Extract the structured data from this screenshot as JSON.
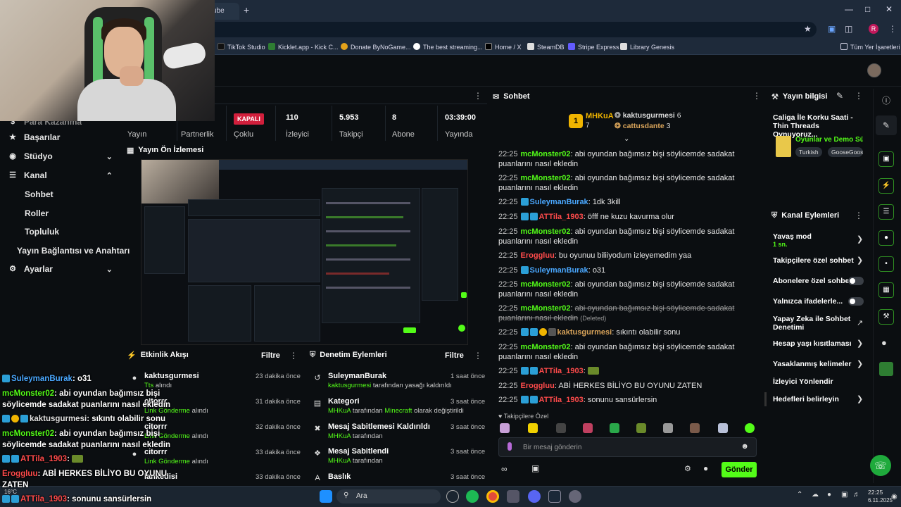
{
  "browser": {
    "tab_title": "ube",
    "new_tab": "+",
    "bookmarks": [
      "TikTok Studio",
      "Kicklet.app - Kick C...",
      "Donate ByNoGame...",
      "The best streaming...",
      "Home / X",
      "SteamDB",
      "Stripe Express",
      "Library Genesis"
    ],
    "all_bookmarks": "Tüm Yer İşaretleri",
    "profile_letter": "R"
  },
  "sidebar": {
    "cut_item": "Para Kazanma",
    "items": [
      {
        "label": "Başarılar",
        "icon": "trophy-icon"
      },
      {
        "label": "Stüdyo",
        "icon": "studio-icon"
      },
      {
        "label": "Kanal",
        "icon": "channel-icon"
      }
    ],
    "sub_items": [
      "Sohbet",
      "Roller",
      "Topluluk",
      "Yayın Bağlantısı ve Anahtarı"
    ],
    "settings": "Ayarlar"
  },
  "stats": {
    "cut_labels": [
      "Yayın",
      "Partnerlik"
    ],
    "multi_badge": "KAPALI",
    "multi_label": "Çoklu",
    "viewers": "110",
    "viewers_label": "İzleyici",
    "followers": "5.953",
    "followers_label": "Takipçi",
    "subs": "8",
    "subs_label": "Abone",
    "uptime": "03:39:00",
    "uptime_label": "Yayında"
  },
  "preview": {
    "title": "Yayın Ön İzlemesi"
  },
  "activity": {
    "title": "Etkinlik Akışı",
    "filter": "Filtre",
    "rows": [
      {
        "name": "kaktusgurmesi",
        "sub": "Tts",
        "sub2": "alındı",
        "time": "23 dakika önce"
      },
      {
        "name": "citorrr",
        "sub": "Link Gönderme",
        "sub2": "alındı",
        "time": "31 dakika önce"
      },
      {
        "name": "citorrr",
        "sub": "Link Gönderme",
        "sub2": "alındı",
        "time": "32 dakika önce"
      },
      {
        "name": "citorrr",
        "sub": "Link Gönderme",
        "sub2": "alındı",
        "time": "33 dakika önce"
      },
      {
        "name": "lankedisi",
        "sub": "",
        "sub2": "",
        "time": "33 dakika önce"
      }
    ]
  },
  "moderation": {
    "title": "Denetim Eylemleri",
    "filter": "Filtre",
    "rows": [
      {
        "name": "SuleymanBurak",
        "sub": "kaktusgurmesi",
        "sub2": "tarafından yasağı kaldırıldı",
        "time": "1 saat önce"
      },
      {
        "name": "Kategori",
        "sub": "MHKuA",
        "sub2": "tarafından",
        "sub3": "Minecraft",
        "sub4": "olarak değiştirildi",
        "time": "3 saat önce"
      },
      {
        "name": "Mesaj Sabitlemesi Kaldırıldı",
        "sub": "MHKuA",
        "sub2": "tarafından",
        "time": "3 saat önce"
      },
      {
        "name": "Mesaj Sabitlendi",
        "sub": "MHKuA",
        "sub2": "tarafından",
        "time": "3 saat önce"
      },
      {
        "name": "Baslık",
        "sub": "",
        "sub2": "",
        "time": "3 saat önce"
      }
    ]
  },
  "chat": {
    "title": "Sohbet",
    "leader_rank": "1",
    "leader_name": "MHKuA",
    "leader_count": "7",
    "top2_name": "kaktusgurmesi",
    "top2_count": "6",
    "top3_name": "cattusdante",
    "top3_count": "3",
    "messages": [
      {
        "time": "22:25",
        "user": "mcMonster02",
        "color": "#53fc18",
        "text": "abi oyundan bağımsız bişi söylicemde sadakat puanlarını nasıl ekledin"
      },
      {
        "time": "22:25",
        "user": "mcMonster02",
        "color": "#53fc18",
        "text": "abi oyundan bağımsız bişi söylicemde sadakat puanlarını nasıl ekledin"
      },
      {
        "time": "22:25",
        "user": "SuleymanBurak",
        "color": "#4aa8ff",
        "text": "1dk 3kill"
      },
      {
        "time": "22:25",
        "user": "ATTila_1903",
        "color": "#ff4b4b",
        "text": "öfff ne kuzu kavurma olur"
      },
      {
        "time": "22:25",
        "user": "mcMonster02",
        "color": "#53fc18",
        "text": "abi oyundan bağımsız bişi söylicemde sadakat puanlarını nasıl ekledin"
      },
      {
        "time": "22:25",
        "user": "Eroggluu",
        "color": "#ff4b4b",
        "text": "bu oyunuu biliiyodum izleyemedim yaa"
      },
      {
        "time": "22:25",
        "user": "SuleymanBurak",
        "color": "#4aa8ff",
        "text": "o31"
      },
      {
        "time": "22:25",
        "user": "mcMonster02",
        "color": "#53fc18",
        "text": "abi oyundan bağımsız bişi söylicemde sadakat puanlarını nasıl ekledin"
      },
      {
        "time": "22:25",
        "user": "mcMonster02",
        "color": "#53fc18",
        "text": "abi oyundan bağımsız bişi söylicemde sadakat puanlarını nasıl ekledin",
        "deleted": "(Deleted)"
      },
      {
        "time": "22:25",
        "user": "kaktusgurmesi",
        "color": "#d9a45a",
        "text": "sıkıntı olabilir sonu"
      },
      {
        "time": "22:25",
        "user": "mcMonster02",
        "color": "#53fc18",
        "text": "abi oyundan bağımsız bişi söylicemde sadakat puanlarını nasıl ekledin"
      },
      {
        "time": "22:25",
        "user": "ATTila_1903",
        "color": "#ff4b4b",
        "text": ""
      },
      {
        "time": "22:25",
        "user": "Eroggluu",
        "color": "#ff4b4b",
        "text": "ABİ HERKES BİLİYO BU OYUNU ZATEN"
      },
      {
        "time": "22:25",
        "user": "ATTila_1903",
        "color": "#ff4b4b",
        "text": "sonunu sansürlersin"
      }
    ],
    "followers_only": "Takipçilere Özel",
    "placeholder": "Bir mesaj gönderin",
    "send": "Gönder"
  },
  "stream_info": {
    "title": "Yayın bilgisi",
    "stream_title": "Caliga İle Korku Saati - Thin Threads Oynuyoruz...",
    "category": "Oyunlar ve Demo Sür",
    "tags": [
      "Turkish",
      "GooseGoos"
    ]
  },
  "channel_actions": {
    "title": "Kanal Eylemleri",
    "slow_mode": "Yavaş mod",
    "slow_value": "1 sn.",
    "items": [
      "Takipçilere özel sohbet",
      "Abonelere özel sohbet",
      "Yalnızca ifadelerle...",
      "Yapay Zeka ile Sohbet Denetimi",
      "Hesap yaşı kısıtlaması",
      "Yasaklanmış kelimeler",
      "İzleyici Yönlendir",
      "Hedefleri belirleyin"
    ]
  },
  "overlay_chat": [
    {
      "user": "SuleymanBurak",
      "text": ": o31"
    },
    {
      "user": "mcMonster02",
      "text": ": abi oyundan bağımsız bişi"
    },
    {
      "user": "",
      "text": "söylicemde sadakat puanlarını nasıl ekledin"
    },
    {
      "user": "kaktusgurmesi",
      "text": ": sıkıntı olabilir sonu"
    },
    {
      "user": "mcMonster02",
      "text": ": abi oyundan bağımsız bişi"
    },
    {
      "user": "",
      "text": "söylicemde sadakat puanlarını nasıl ekledin"
    },
    {
      "user": "ATTila_1903",
      "text": ":"
    },
    {
      "user": "Eroggluu",
      "text": ": ABİ HERKES BİLİYO BU OYUNU"
    },
    {
      "user": "",
      "text": "ZATEN"
    },
    {
      "user": "ATTila_1903",
      "text": ": sonunu sansürlersin"
    }
  ],
  "taskbar": {
    "search": "Ara",
    "temp": "16°C",
    "time": "22:25",
    "date": "6.11.2025"
  }
}
